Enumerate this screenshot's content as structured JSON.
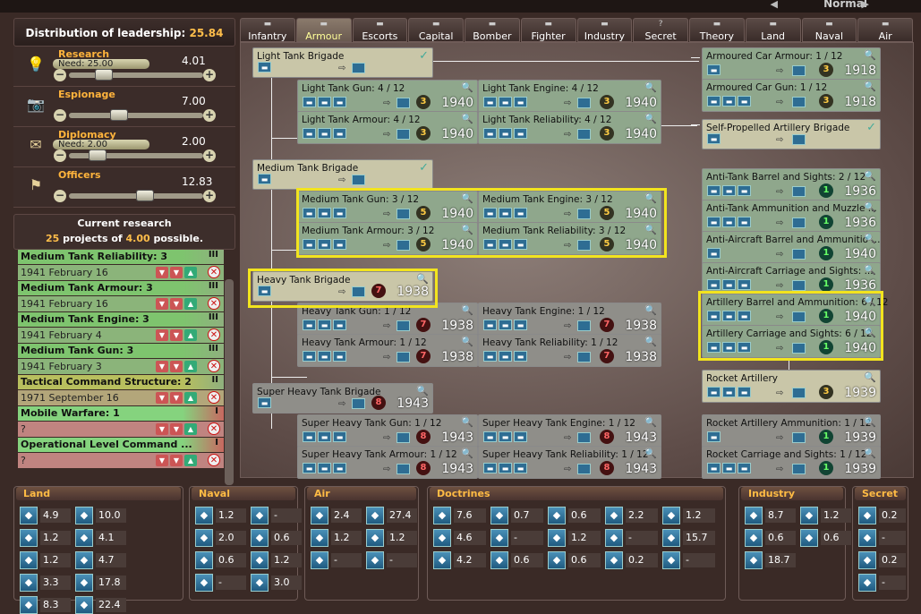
{
  "topbar": {
    "difficulty": "Normal"
  },
  "leadership": {
    "label": "Distribution of leadership:",
    "value": "25.84"
  },
  "allocations": [
    {
      "name": "Research",
      "need": "Need: 25.00",
      "value": "4.01",
      "icon": "bulb-icon",
      "glyph": "💡",
      "level": 0.22
    },
    {
      "name": "Espionage",
      "need": "",
      "value": "7.00",
      "icon": "camera-icon",
      "glyph": "📷",
      "level": 0.35
    },
    {
      "name": "Diplomacy",
      "need": "Need: 2.00",
      "value": "2.00",
      "icon": "envelope-icon",
      "glyph": "✉",
      "level": 0.17
    },
    {
      "name": "Officers",
      "need": "",
      "value": "12.83",
      "icon": "flag-icon",
      "glyph": "⚑",
      "level": 0.58
    }
  ],
  "current_research": {
    "title": "Current research",
    "count": "25",
    "mid": " projects of ",
    "possible": "4.00",
    "tail": " possible."
  },
  "queue": [
    {
      "name": "Medium Tank Reliability: 3",
      "date": "1941 February 16",
      "rank": "III",
      "color": "#7ec46e",
      "datecol": "#8bb47a"
    },
    {
      "name": "Medium Tank Armour: 3",
      "date": "1941 February 16",
      "rank": "III",
      "color": "#7ec46e",
      "datecol": "#8bb47a"
    },
    {
      "name": "Medium Tank Engine: 3",
      "date": "1941 February 4",
      "rank": "III",
      "color": "#7ec46e",
      "datecol": "#8bb47a"
    },
    {
      "name": "Medium Tank Gun: 3",
      "date": "1941 February 3",
      "rank": "III",
      "color": "#7ec46e",
      "datecol": "#8bb47a"
    },
    {
      "name": "Tactical Command Structure: 2",
      "date": "1971 September 16",
      "rank": "II",
      "color": "#b8bf5e",
      "datecol": "#b3a67a"
    },
    {
      "name": "Mobile Warfare: 1",
      "date": "?",
      "rank": "I",
      "color": "#85d37e",
      "datecol": "#c08480"
    },
    {
      "name": "Operational Level Command ...",
      "date": "?",
      "rank": "I",
      "color": "#85d37e",
      "datecol": "#c08480"
    }
  ],
  "tabs": [
    {
      "label": "Infantry",
      "icon": "infantry-icon"
    },
    {
      "label": "Armour",
      "icon": "tank-icon"
    },
    {
      "label": "Escorts",
      "icon": "escort-ship-icon"
    },
    {
      "label": "Capital",
      "icon": "capital-ship-icon"
    },
    {
      "label": "Bomber",
      "icon": "bomber-icon"
    },
    {
      "label": "Fighter",
      "icon": "fighter-icon"
    },
    {
      "label": "Industry",
      "icon": "factory-icon"
    },
    {
      "label": "Secret",
      "icon": "question-icon",
      "glyph": "?"
    },
    {
      "label": "Theory",
      "icon": "book-icon"
    },
    {
      "label": "Land",
      "icon": "land-doctrine-icon"
    },
    {
      "label": "Naval",
      "icon": "naval-doctrine-icon"
    },
    {
      "label": "Air",
      "icon": "air-doctrine-icon"
    }
  ],
  "tech": [
    {
      "title": "Light Tank Brigade",
      "num": "",
      "year": "",
      "state": "done"
    },
    {
      "title": "Light Tank Gun: 4 / 12",
      "num": "3",
      "year": "1940",
      "state": "green"
    },
    {
      "title": "Light Tank Engine: 4 / 12",
      "num": "3",
      "year": "1940",
      "state": "green"
    },
    {
      "title": "Light Tank Armour: 4 / 12",
      "num": "3",
      "year": "1940",
      "state": "green"
    },
    {
      "title": "Light Tank Reliability: 4 / 12",
      "num": "3",
      "year": "1940",
      "state": "green"
    },
    {
      "title": "Medium Tank Brigade",
      "num": "",
      "year": "",
      "state": "done"
    },
    {
      "title": "Medium Tank Gun: 3 / 12",
      "num": "5",
      "year": "1940",
      "state": "green"
    },
    {
      "title": "Medium Tank Engine: 3 / 12",
      "num": "5",
      "year": "1940",
      "state": "green"
    },
    {
      "title": "Medium Tank Armour: 3 / 12",
      "num": "5",
      "year": "1940",
      "state": "green"
    },
    {
      "title": "Medium Tank Reliability: 3 / 12",
      "num": "5",
      "year": "1940",
      "state": "green"
    },
    {
      "title": "Heavy Tank Brigade",
      "num": "7",
      "year": "1938",
      "state": "done"
    },
    {
      "title": "Heavy Tank Gun: 1 / 12",
      "num": "7",
      "year": "1938",
      "state": "grey"
    },
    {
      "title": "Heavy Tank Engine: 1 / 12",
      "num": "7",
      "year": "1938",
      "state": "grey"
    },
    {
      "title": "Heavy Tank Armour: 1 / 12",
      "num": "7",
      "year": "1938",
      "state": "grey"
    },
    {
      "title": "Heavy Tank Reliability: 1 / 12",
      "num": "7",
      "year": "1938",
      "state": "grey"
    },
    {
      "title": "Super Heavy Tank Brigade",
      "num": "8",
      "year": "1943",
      "state": "grey"
    },
    {
      "title": "Super Heavy Tank Gun: 1 / 12",
      "num": "8",
      "year": "1943",
      "state": "grey"
    },
    {
      "title": "Super Heavy Tank Engine: 1 / 12",
      "num": "8",
      "year": "1943",
      "state": "grey"
    },
    {
      "title": "Super Heavy Tank Armour: 1 / 12",
      "num": "8",
      "year": "1943",
      "state": "grey"
    },
    {
      "title": "Super Heavy Tank Reliability: 1 / 12",
      "num": "8",
      "year": "1943",
      "state": "grey"
    },
    {
      "title": "Armoured Car Armour: 1 / 12",
      "num": "3",
      "year": "1918",
      "state": "green"
    },
    {
      "title": "Armoured Car Gun: 1 / 12",
      "num": "3",
      "year": "1918",
      "state": "green"
    },
    {
      "title": "Self-Propelled Artillery Brigade",
      "num": "",
      "year": "",
      "state": "done"
    },
    {
      "title": "Anti-Tank Barrel and Sights: 2 / 12",
      "num": "1",
      "year": "1936",
      "state": "green"
    },
    {
      "title": "Anti-Tank Ammunition and Muzzle ...",
      "num": "1",
      "year": "1936",
      "state": "green"
    },
    {
      "title": "Anti-Aircraft Barrel and Ammunitio ...",
      "num": "1",
      "year": "1940",
      "state": "green"
    },
    {
      "title": "Anti-Aircraft Carriage and Sights: ...",
      "num": "1",
      "year": "1936",
      "state": "green"
    },
    {
      "title": "Artillery Barrel and Ammunition: 6 / 12",
      "num": "1",
      "year": "1940",
      "state": "green"
    },
    {
      "title": "Artillery Carriage and Sights: 6 / 12",
      "num": "1",
      "year": "1940",
      "state": "green"
    },
    {
      "title": "Rocket Artillery",
      "num": "3",
      "year": "1939",
      "state": "done"
    },
    {
      "title": "Rocket Artillery Ammunition: 1 / 12",
      "num": "1",
      "year": "1939",
      "state": "grey"
    },
    {
      "title": "Rocket Carriage and Sights: 1 / 12",
      "num": "1",
      "year": "1939",
      "state": "grey"
    }
  ],
  "bottom": {
    "land": {
      "title": "Land",
      "stats": [
        "4.9",
        "10.0",
        "1.2",
        "4.1",
        "1.2",
        "4.7",
        "3.3",
        "17.8",
        "8.3",
        "22.4"
      ]
    },
    "naval": {
      "title": "Naval",
      "stats": [
        "1.2",
        "-",
        "2.0",
        "0.6",
        "0.6",
        "1.2",
        "-",
        "3.0"
      ]
    },
    "air": {
      "title": "Air",
      "stats": [
        "2.4",
        "27.4",
        "1.2",
        "1.2",
        "-",
        "-"
      ]
    },
    "doctrines": {
      "title": "Doctrines",
      "stats": [
        "7.6",
        "0.7",
        "0.6",
        "2.2",
        "1.2",
        "4.6",
        "-",
        "1.2",
        "-",
        "15.7",
        "4.2",
        "0.6",
        "0.6",
        "0.2",
        "-"
      ]
    },
    "industry": {
      "title": "Industry",
      "stats": [
        "8.7",
        "1.2",
        "0.6",
        "0.6",
        "18.7"
      ]
    },
    "secret": {
      "title": "Secret",
      "stats": [
        "0.2",
        "-",
        "0.2",
        "-"
      ]
    }
  }
}
